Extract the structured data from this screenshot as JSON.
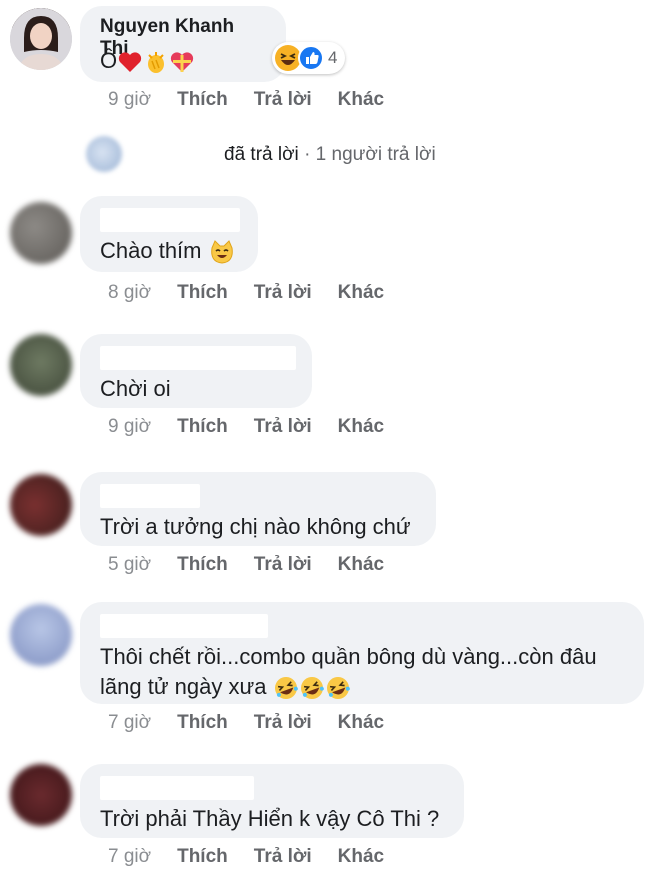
{
  "comments": [
    {
      "author": "Nguyen Khanh Thi",
      "text": "Ô",
      "emojis": [
        "heart",
        "clap",
        "gift-heart"
      ],
      "reactions": {
        "icons": [
          "haha",
          "like"
        ],
        "count": "4"
      },
      "time": "9 giờ",
      "like": "Thích",
      "reply": "Trả lời",
      "more": "Khác"
    },
    {
      "text": "Chào thím",
      "emojis": [
        "smiling-cat"
      ],
      "time": "8 giờ",
      "like": "Thích",
      "reply": "Trả lời",
      "more": "Khác"
    },
    {
      "text": "Chời oi",
      "time": "9 giờ",
      "like": "Thích",
      "reply": "Trả lời",
      "more": "Khác"
    },
    {
      "text": "Trời a tưởng chị nào không chứ",
      "time": "5 giờ",
      "like": "Thích",
      "reply": "Trả lời",
      "more": "Khác"
    },
    {
      "text_line1": "Thôi chết rồi...combo quần bông dù vàng...còn đâu",
      "text_line2": "lãng tử ngày xưa",
      "emojis": [
        "rofl",
        "rofl",
        "rofl"
      ],
      "time": "7 giờ",
      "like": "Thích",
      "reply": "Trả lời",
      "more": "Khác"
    },
    {
      "text": "Trời phải Thầy Hiển k vậy Cô Thi ?",
      "time": "7 giờ",
      "like": "Thích",
      "reply": "Trả lời",
      "more": "Khác"
    }
  ],
  "reply_summary": {
    "text": "đã trả lời",
    "separator": "·",
    "count_text": "1 người trả lời"
  },
  "colors": {
    "bubble": "#f0f2f5",
    "meta": "#65676b",
    "like_blue": "#1877f2",
    "haha_yellow": "#f7b125"
  }
}
